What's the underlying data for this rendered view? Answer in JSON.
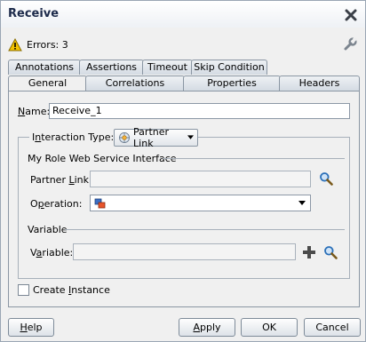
{
  "window": {
    "title": "Receive"
  },
  "status": {
    "errors_text": "Errors: 3"
  },
  "tabs_back": [
    {
      "label": "Annotations"
    },
    {
      "label": "Assertions"
    },
    {
      "label": "Timeout"
    },
    {
      "label": "Skip Condition"
    }
  ],
  "tabs_front": [
    {
      "label": "General",
      "active": true
    },
    {
      "label": "Correlations"
    },
    {
      "label": "Properties"
    },
    {
      "label": "Headers"
    }
  ],
  "general": {
    "name_label_u": "N",
    "name_label_rest": "ame:",
    "name_value": "Receive_1",
    "interaction_label_pre": "I",
    "interaction_label_u": "n",
    "interaction_label_rest": "teraction Type:",
    "interaction_button": "Partner Link",
    "my_role_title": "My Role Web Service Interface",
    "partner_link_label_pre": "Partner ",
    "partner_link_label_u": "L",
    "partner_link_label_rest": "ink:",
    "partner_link_value": "",
    "operation_label_pre": "O",
    "operation_label_u": "p",
    "operation_label_rest": "eration:",
    "operation_value": "",
    "variable_section": "Variable",
    "variable_label_pre": "V",
    "variable_label_u": "a",
    "variable_label_rest": "riable:",
    "variable_value": "",
    "create_instance_pre": "Create ",
    "create_instance_u": "I",
    "create_instance_rest": "nstance",
    "create_instance_checked": false
  },
  "footer": {
    "help_u": "H",
    "help_rest": "elp",
    "apply_u": "A",
    "apply_rest": "pply",
    "ok": "OK",
    "cancel": "Cancel"
  },
  "colors": {
    "warning": "#f2c200",
    "search": "#2a6fb8",
    "add": "#4b4b4b"
  }
}
